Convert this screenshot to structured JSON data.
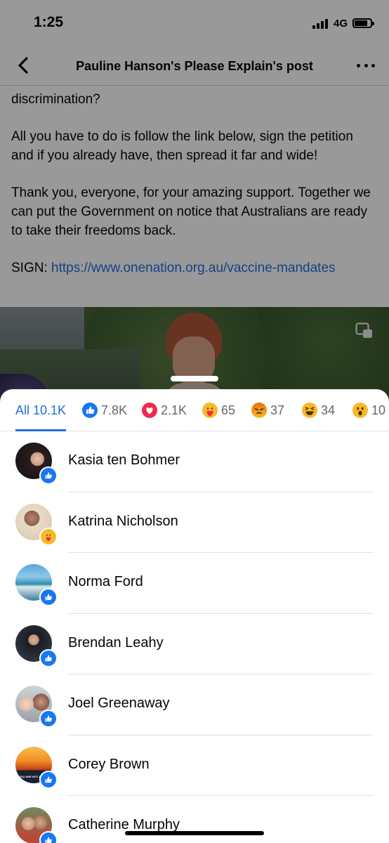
{
  "status_bar": {
    "time": "1:25",
    "network": "4G"
  },
  "nav": {
    "title": "Pauline Hanson's Please Explain's post",
    "back_icon": "chevron-left-icon",
    "more_icon": "more-dots-icon"
  },
  "post": {
    "cut_line": "… ow … discrimination …",
    "line_discrimination": "discrimination?",
    "paragraph_2": "All you have to do is follow the link below, sign the petition and if you already have, then spread it far and wide!",
    "paragraph_3": "Thank you, everyone, for your amazing support. Together we can put the Government on notice that Australians are ready to take their freedoms back.",
    "sign_label": "SIGN: ",
    "sign_link": "https://www.onenation.org.au/vaccine-mandates"
  },
  "reactions_tabs": [
    {
      "label": "All 10.1K",
      "icon": ""
    },
    {
      "label": "7.8K",
      "icon": "like-icon"
    },
    {
      "label": "2.1K",
      "icon": "love-icon"
    },
    {
      "label": "65",
      "icon": "care-icon"
    },
    {
      "label": "37",
      "icon": "angry-icon"
    },
    {
      "label": "34",
      "icon": "haha-icon"
    },
    {
      "label": "10",
      "icon": "wow-icon"
    }
  ],
  "reactors": [
    {
      "name": "Kasia ten Bohmer",
      "reaction": "like-icon"
    },
    {
      "name": "Katrina Nicholson",
      "reaction": "care-icon"
    },
    {
      "name": "Norma Ford",
      "reaction": "like-icon"
    },
    {
      "name": "Brendan Leahy",
      "reaction": "like-icon"
    },
    {
      "name": "Joel Greenaway",
      "reaction": "like-icon"
    },
    {
      "name": "Corey Brown",
      "reaction": "like-icon"
    },
    {
      "name": "Catherine Murphy",
      "reaction": "like-icon"
    }
  ],
  "avatar_image_text": {
    "corey_brown": "YOU ARE NOT ALONE"
  },
  "colors": {
    "accent": "#216fdb",
    "like": "#1877f2",
    "love": "#f02849",
    "angry": "#e9710f",
    "emoji_yellow": "#f7b928"
  }
}
